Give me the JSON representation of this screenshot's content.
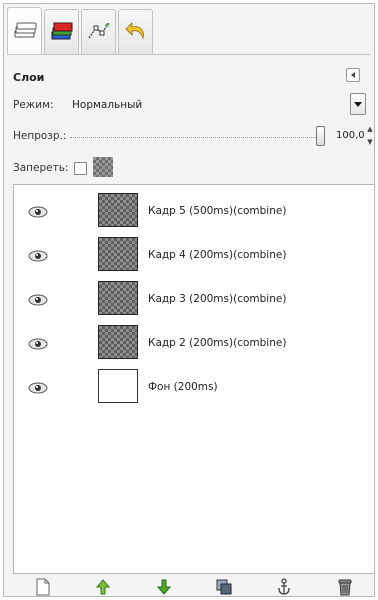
{
  "dock": {
    "tabs": [
      {
        "icon": "layers-tab-icon"
      },
      {
        "icon": "channels-tab-icon"
      },
      {
        "icon": "paths-tab-icon"
      },
      {
        "icon": "undo-history-tab-icon"
      }
    ],
    "title": "Слои"
  },
  "mode": {
    "label": "Режим:",
    "value": "Нормальный"
  },
  "opacity": {
    "label": "Непрозр.:",
    "value": "100,0",
    "level_percent": 100
  },
  "lock": {
    "label": "Запереть:"
  },
  "layers": [
    {
      "name": "Кадр 5 (500ms)(combine)"
    },
    {
      "name": "Кадр 4 (200ms)(combine)"
    },
    {
      "name": "Кадр 3 (200ms)(combine)"
    },
    {
      "name": "Кадр 2 (200ms)(combine)"
    },
    {
      "name": "Фон (200ms)"
    }
  ],
  "bottom_buttons": [
    {
      "icon": "new-layer-icon"
    },
    {
      "icon": "raise-layer-icon"
    },
    {
      "icon": "lower-layer-icon"
    },
    {
      "icon": "duplicate-layer-icon"
    },
    {
      "icon": "anchor-layer-icon"
    },
    {
      "icon": "delete-layer-icon"
    }
  ],
  "colors": {
    "raise_green": "#7fbf3f",
    "lower_green": "#4ea82a",
    "channels_red": "#d8282a",
    "undo_yellow": "#f0c030"
  }
}
